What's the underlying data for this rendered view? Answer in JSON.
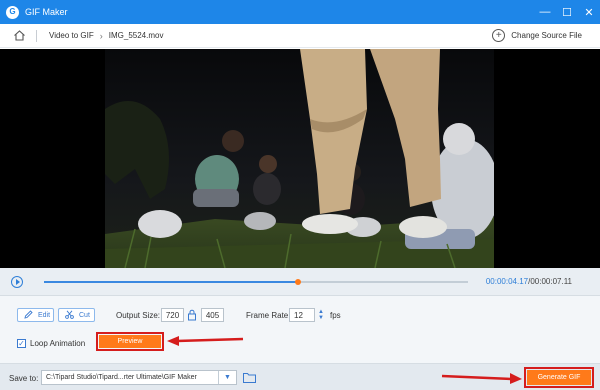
{
  "window": {
    "title": "GIF Maker",
    "app_icon_glyph": "G",
    "controls": {
      "minimize": "—",
      "maximize": "☐",
      "close": "✕"
    }
  },
  "nav": {
    "breadcrumb": [
      "Video to GIF",
      "IMG_5524.mov"
    ],
    "separator": "›",
    "change_source": "Change Source File"
  },
  "playback": {
    "current_time": "00:00:04.17",
    "total_time": "/00:00:07.11",
    "progress": 0.6
  },
  "settings": {
    "edit_label": "Edit",
    "cut_label": "Cut",
    "output_size_label": "Output Size:",
    "width": "720",
    "height": "405",
    "frame_rate_label": "Frame Rate:",
    "frame_rate": "12",
    "fps_unit": "fps",
    "loop_label": "Loop Animation",
    "loop_checked": true,
    "preview_label": "Preview"
  },
  "bottom": {
    "save_to_label": "Save to:",
    "path": "C:\\Tipard Studio\\Tipard...rter Ultimate\\GIF Maker",
    "generate_label": "Generate GIF"
  },
  "colors": {
    "titlebar": "#1e86e8",
    "accent_blue": "#2f7fd8",
    "orange": "#ff7a1a",
    "highlight_red": "#d51d1d"
  },
  "icons": [
    "app-logo-icon",
    "minimize-icon",
    "maximize-icon",
    "close-icon",
    "home-icon",
    "chevron-right-icon",
    "plus-circle-icon",
    "play-icon",
    "edit-icon",
    "cut-icon",
    "lock-icon",
    "stepper-icon",
    "checkbox-icon",
    "dropdown-icon",
    "folder-icon",
    "arrow-annotation-icon"
  ]
}
